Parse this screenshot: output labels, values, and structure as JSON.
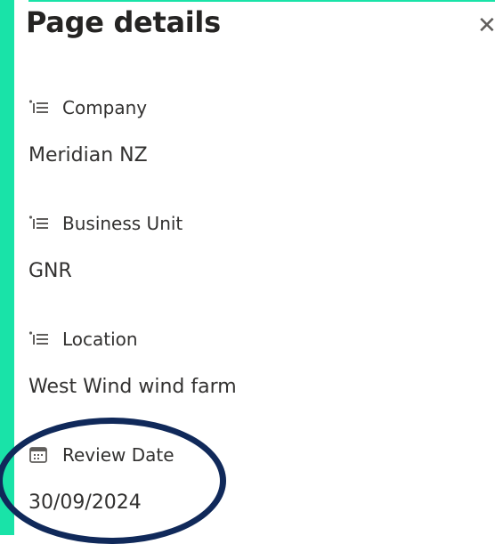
{
  "panel": {
    "title": "Page details",
    "close_icon": "close-icon"
  },
  "fields": [
    {
      "label": "Company",
      "value": "Meridian NZ",
      "icon": "list-choice-icon"
    },
    {
      "label": "Business Unit",
      "value": "GNR",
      "icon": "list-choice-icon"
    },
    {
      "label": "Location",
      "value": "West Wind wind farm",
      "icon": "list-choice-icon"
    },
    {
      "label": "Review Date",
      "value": "30/09/2024",
      "icon": "calendar-icon"
    }
  ],
  "colors": {
    "accent": "#19e3a8",
    "highlight": "#10295a",
    "text": "#323130"
  }
}
